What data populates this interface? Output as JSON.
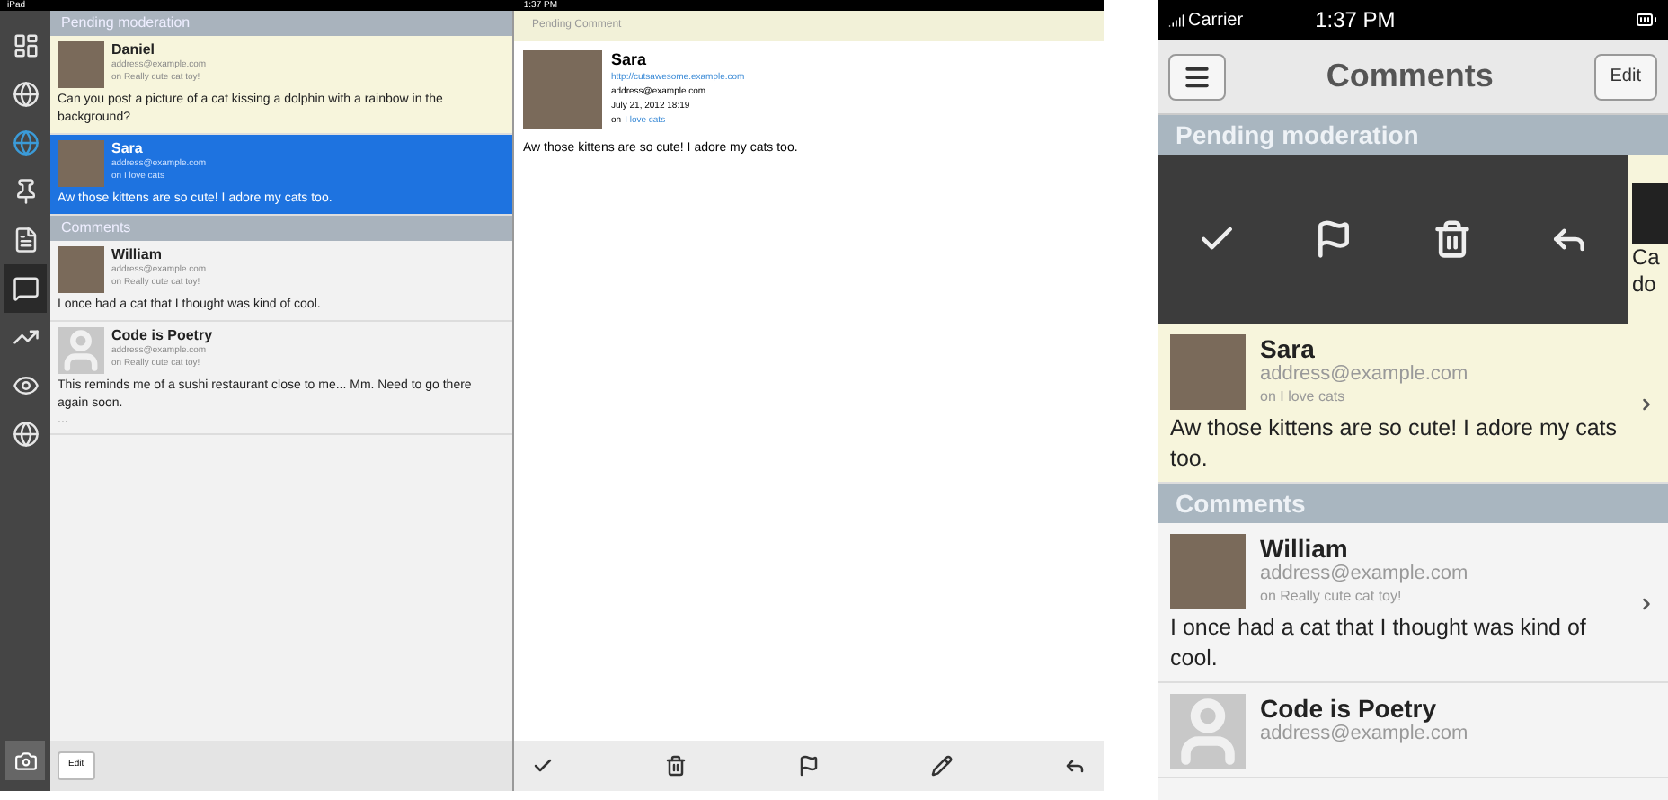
{
  "ipad": {
    "status_bar": {
      "device": "iPad",
      "time": "1:37 PM"
    },
    "sidebar": {
      "items": [
        {
          "selected": false
        },
        {
          "selected": false
        },
        {
          "selected": false
        },
        {
          "selected": false
        },
        {
          "selected": false
        },
        {
          "selected": true
        },
        {
          "selected": false
        },
        {
          "selected": false
        },
        {
          "selected": false
        }
      ],
      "edit_button": "Edit"
    },
    "list": {
      "sections": [
        {
          "kind": "pending",
          "title": "Pending moderation",
          "comments": [
            {
              "author": "Daniel",
              "kind": "photo",
              "email": "address@example.com",
              "on": "on Really cute cat toy!",
              "text": "Can you post a picture of a cat kissing a dolphin with a rainbow in the background?",
              "selected": false
            },
            {
              "author": "Sara",
              "kind": "photo",
              "email": "address@example.com",
              "on": "on I love cats",
              "text": "Aw those kittens are so cute! I adore my cats too.",
              "selected": true
            }
          ]
        },
        {
          "kind": "approved",
          "title": "Comments",
          "comments": [
            {
              "author": "William",
              "kind": "photo",
              "email": "address@example.com",
              "on": "on Really cute cat toy!",
              "text": "I once had a cat that I thought was kind of cool.",
              "selected": false
            },
            {
              "author": "Code is Poetry",
              "kind": "default",
              "email": "address@example.com",
              "on": "on Really cute cat toy!",
              "text": "This reminds me of a sushi restaurant close to me... Mm. Need to go there again soon.",
              "more": "...",
              "selected": false
            }
          ]
        }
      ]
    },
    "detail": {
      "header": "Pending Comment",
      "author": "Sara",
      "url": "http://cutsawesome.example.com",
      "email": "address@example.com",
      "date": "July 21, 2012 18:19",
      "on_prefix": "on",
      "post": "I love cats",
      "text": "Aw those kittens are so cute! I adore my cats too.",
      "toolbar": [
        {
          "kind": "approve"
        },
        {
          "kind": "trash"
        },
        {
          "kind": "flag"
        },
        {
          "kind": "edit"
        },
        {
          "kind": "reply"
        }
      ]
    }
  },
  "iphone": {
    "status_bar": {
      "carrier": "Carrier",
      "time": "1:37 PM"
    },
    "nav": {
      "title": "Comments",
      "edit_button": "Edit"
    },
    "sections": [
      {
        "kind": "pending",
        "title": "Pending moderation",
        "swipe_actions": [
          {
            "kind": "approve"
          },
          {
            "kind": "flag"
          },
          {
            "kind": "trash"
          },
          {
            "kind": "reply"
          }
        ],
        "peek_lines": [
          "Ca",
          "do"
        ],
        "comments": [
          {
            "author": "Sara",
            "kind": "photo",
            "email": "address@example.com",
            "on": "on I love cats",
            "text": "Aw those kittens are so cute! I adore my cats too."
          }
        ]
      },
      {
        "kind": "approved",
        "title": "Comments",
        "comments": [
          {
            "author": "William",
            "kind": "photo",
            "email": "address@example.com",
            "on": "on Really cute cat toy!",
            "text": "I once had a cat that I thought was kind of cool."
          },
          {
            "author": "Code is Poetry",
            "kind": "default",
            "email": "address@example.com"
          }
        ]
      }
    ]
  }
}
